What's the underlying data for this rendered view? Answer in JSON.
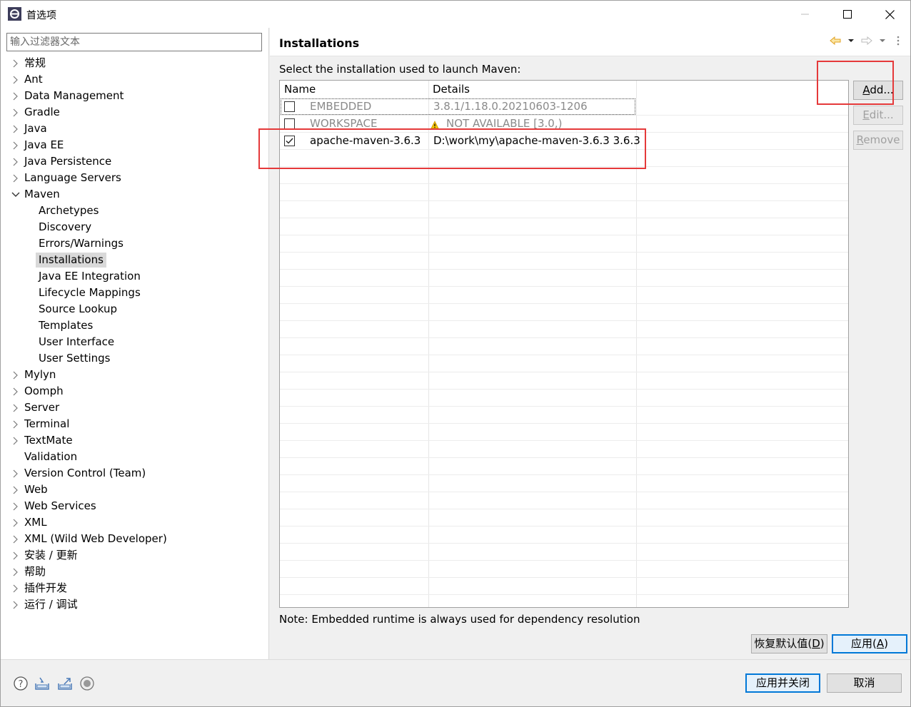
{
  "window": {
    "title": "首选项",
    "controls": {
      "minimize": "minimize",
      "maximize": "maximize",
      "close": "close"
    }
  },
  "filter": {
    "placeholder": "输入过滤器文本",
    "value": ""
  },
  "tree": {
    "items": [
      {
        "label": "常规",
        "expandable": true,
        "expanded": false,
        "level": 0
      },
      {
        "label": "Ant",
        "expandable": true,
        "expanded": false,
        "level": 0
      },
      {
        "label": "Data Management",
        "expandable": true,
        "expanded": false,
        "level": 0
      },
      {
        "label": "Gradle",
        "expandable": true,
        "expanded": false,
        "level": 0
      },
      {
        "label": "Java",
        "expandable": true,
        "expanded": false,
        "level": 0
      },
      {
        "label": "Java EE",
        "expandable": true,
        "expanded": false,
        "level": 0
      },
      {
        "label": "Java Persistence",
        "expandable": true,
        "expanded": false,
        "level": 0
      },
      {
        "label": "Language Servers",
        "expandable": true,
        "expanded": false,
        "level": 0
      },
      {
        "label": "Maven",
        "expandable": true,
        "expanded": true,
        "level": 0
      },
      {
        "label": "Archetypes",
        "expandable": false,
        "level": 1
      },
      {
        "label": "Discovery",
        "expandable": false,
        "level": 1
      },
      {
        "label": "Errors/Warnings",
        "expandable": false,
        "level": 1
      },
      {
        "label": "Installations",
        "expandable": false,
        "level": 1,
        "selected": true
      },
      {
        "label": "Java EE Integration",
        "expandable": false,
        "level": 1
      },
      {
        "label": "Lifecycle Mappings",
        "expandable": false,
        "level": 1
      },
      {
        "label": "Source Lookup",
        "expandable": false,
        "level": 1
      },
      {
        "label": "Templates",
        "expandable": false,
        "level": 1
      },
      {
        "label": "User Interface",
        "expandable": false,
        "level": 1
      },
      {
        "label": "User Settings",
        "expandable": false,
        "level": 1
      },
      {
        "label": "Mylyn",
        "expandable": true,
        "expanded": false,
        "level": 0
      },
      {
        "label": "Oomph",
        "expandable": true,
        "expanded": false,
        "level": 0
      },
      {
        "label": "Server",
        "expandable": true,
        "expanded": false,
        "level": 0
      },
      {
        "label": "Terminal",
        "expandable": true,
        "expanded": false,
        "level": 0
      },
      {
        "label": "TextMate",
        "expandable": true,
        "expanded": false,
        "level": 0
      },
      {
        "label": "Validation",
        "expandable": false,
        "level": 0
      },
      {
        "label": "Version Control (Team)",
        "expandable": true,
        "expanded": false,
        "level": 0
      },
      {
        "label": "Web",
        "expandable": true,
        "expanded": false,
        "level": 0
      },
      {
        "label": "Web Services",
        "expandable": true,
        "expanded": false,
        "level": 0
      },
      {
        "label": "XML",
        "expandable": true,
        "expanded": false,
        "level": 0
      },
      {
        "label": "XML (Wild Web Developer)",
        "expandable": true,
        "expanded": false,
        "level": 0
      },
      {
        "label": "安装 / 更新",
        "expandable": true,
        "expanded": false,
        "level": 0
      },
      {
        "label": "帮助",
        "expandable": true,
        "expanded": false,
        "level": 0
      },
      {
        "label": "插件开发",
        "expandable": true,
        "expanded": false,
        "level": 0
      },
      {
        "label": "运行 / 调试",
        "expandable": true,
        "expanded": false,
        "level": 0
      }
    ]
  },
  "page": {
    "title": "Installations",
    "instruction": "Select the installation used to launch Maven:",
    "nav_icons": [
      "back-arrow-icon",
      "dropdown-icon",
      "forward-arrow-icon",
      "dropdown-icon",
      "view-menu-icon"
    ],
    "table": {
      "columns": {
        "name": "Name",
        "details": "Details"
      },
      "rows": [
        {
          "checked": false,
          "name": "EMBEDDED",
          "details": "3.8.1/1.18.0.20210603-1206",
          "disabled": true,
          "focused": true,
          "warning": false
        },
        {
          "checked": false,
          "name": "WORKSPACE",
          "details": "NOT AVAILABLE [3.0,)",
          "disabled": true,
          "focused": false,
          "warning": true
        },
        {
          "checked": true,
          "name": "apache-maven-3.6.3",
          "details": "D:\\work\\my\\apache-maven-3.6.3 3.6.3",
          "disabled": false,
          "focused": false,
          "warning": false
        }
      ]
    },
    "buttons": {
      "add": {
        "prefix": "",
        "mnemonic": "A",
        "suffix": "dd...",
        "enabled": true
      },
      "edit": {
        "prefix": "",
        "mnemonic": "E",
        "suffix": "dit...",
        "enabled": false
      },
      "remove": {
        "prefix": "",
        "mnemonic": "R",
        "suffix": "emove",
        "enabled": false
      }
    },
    "note": "Note: Embedded runtime is always used for dependency resolution",
    "restore_defaults": {
      "prefix": "恢复默认值(",
      "mnemonic": "D",
      "suffix": ")"
    },
    "apply": {
      "prefix": "应用(",
      "mnemonic": "A",
      "suffix": ")"
    }
  },
  "footer": {
    "icons": [
      "help-icon",
      "import-icon",
      "export-icon",
      "record-icon"
    ],
    "apply_close": "应用并关闭",
    "cancel": "取消"
  },
  "colors": {
    "highlight": "#e5393a",
    "selection": "#d9d9d9",
    "primary_border": "#0078d7"
  }
}
